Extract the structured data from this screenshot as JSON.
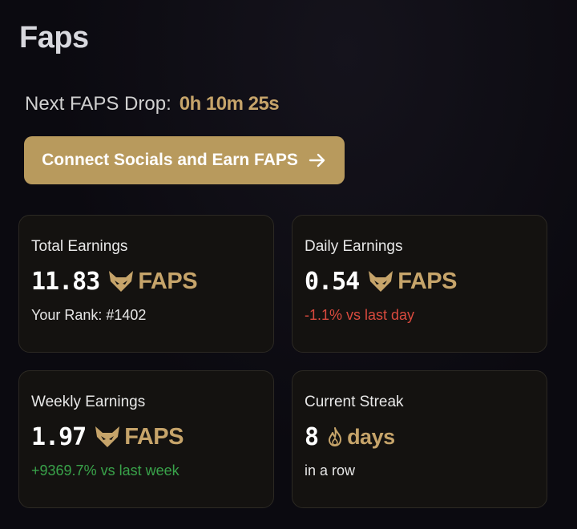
{
  "page": {
    "title": "Faps"
  },
  "drop": {
    "label": "Next FAPS Drop:",
    "time": "0h 10m 25s"
  },
  "connect_button": {
    "label": "Connect Socials and Earn FAPS"
  },
  "cards": {
    "total": {
      "label": "Total Earnings",
      "value": "11.83",
      "unit": "FAPS",
      "sub": "Your Rank: #1402"
    },
    "daily": {
      "label": "Daily Earnings",
      "value": "0.54",
      "unit": "FAPS",
      "sub": "-1.1% vs last day"
    },
    "weekly": {
      "label": "Weekly Earnings",
      "value": "1.97",
      "unit": "FAPS",
      "sub": "+9369.7% vs last week"
    },
    "streak": {
      "label": "Current Streak",
      "value": "8",
      "unit": "days",
      "sub": "in a row"
    }
  },
  "icons": {
    "token": "fox-head-icon",
    "streak": "flame-icon",
    "arrow": "arrow-right-icon"
  },
  "colors": {
    "accent": "#b89a5d",
    "gold_text": "#c6a46a",
    "negative": "#d94a3e",
    "positive": "#39a34a"
  }
}
